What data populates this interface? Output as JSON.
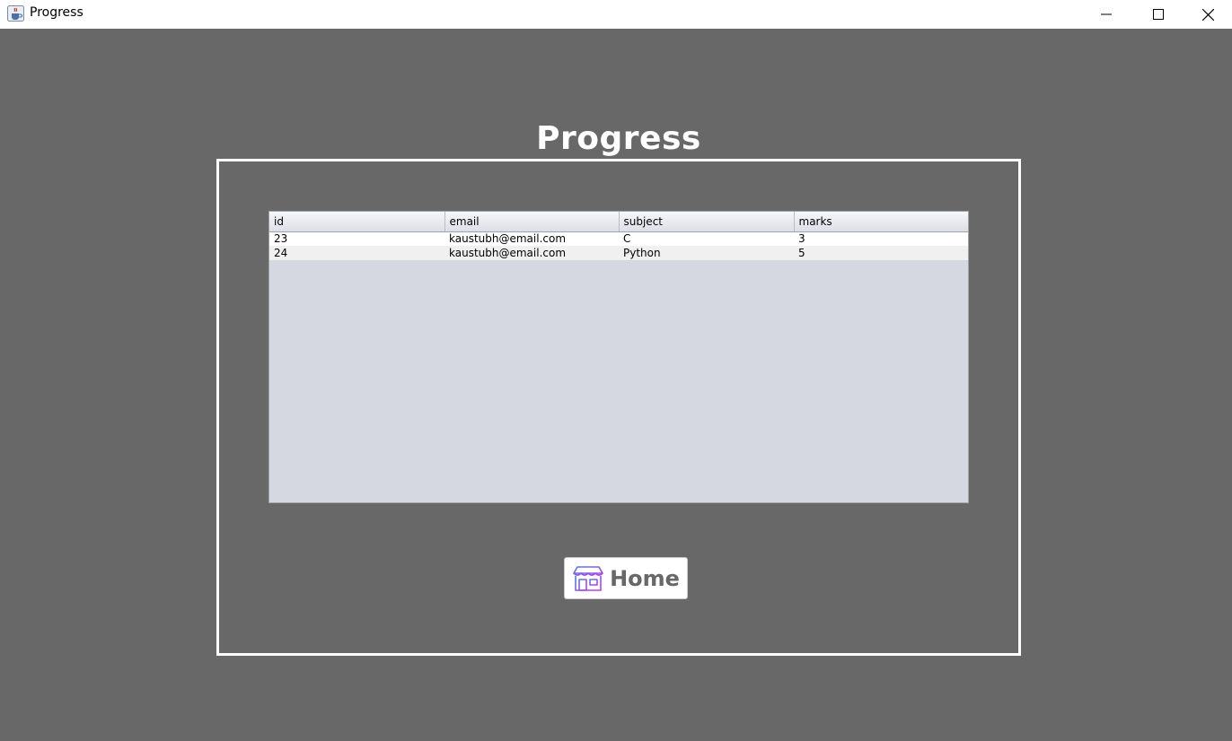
{
  "window": {
    "title": "Progress",
    "app_icon": "java-coffee-icon",
    "controls": {
      "minimize": "minimize-icon",
      "maximize": "maximize-icon",
      "close": "close-icon"
    }
  },
  "main": {
    "heading": "Progress"
  },
  "table": {
    "columns": [
      "id",
      "email",
      "subject",
      "marks"
    ],
    "rows": [
      [
        "23",
        "kaustubh@email.com",
        "C",
        "3"
      ],
      [
        "24",
        "kaustubh@email.com",
        "Python",
        "5"
      ]
    ]
  },
  "home_button": {
    "label": "Home",
    "icon": "store-icon"
  },
  "colors": {
    "background": "#686868",
    "frame_border": "#ffffff",
    "table_empty_area": "#d5d8e0",
    "button_text": "#686868"
  }
}
